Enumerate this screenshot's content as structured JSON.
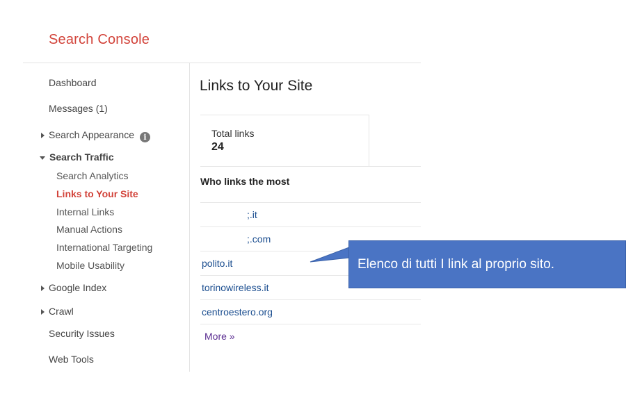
{
  "app": {
    "title": "Search Console"
  },
  "sidebar": {
    "dashboard": "Dashboard",
    "messages": "Messages (1)",
    "search_appearance": "Search Appearance",
    "search_traffic": "Search Traffic",
    "search_traffic_items": [
      {
        "label": "Search Analytics",
        "active": false
      },
      {
        "label": "Links to Your Site",
        "active": true
      },
      {
        "label": "Internal Links",
        "active": false
      },
      {
        "label": "Manual Actions",
        "active": false
      },
      {
        "label": "International Targeting",
        "active": false
      },
      {
        "label": "Mobile Usability",
        "active": false
      }
    ],
    "google_index": "Google Index",
    "crawl": "Crawl",
    "security_issues": "Security Issues",
    "web_tools": "Web Tools",
    "info_icon_glyph": "i"
  },
  "main": {
    "title": "Links to Your Site",
    "total_links": {
      "label": "Total links",
      "value": "24"
    },
    "who_links_heading": "Who links the most",
    "links": [
      ";.it",
      ";.com",
      "polito.it",
      "torinowireless.it",
      "centroestero.org"
    ],
    "more": "More »"
  },
  "callout": {
    "text": "Elenco di tutti I link al proprio sito.",
    "color": "#4a74c4"
  },
  "colors": {
    "brand": "#d2433a",
    "link": "#1a4d8f",
    "visited": "#5b2e91"
  }
}
